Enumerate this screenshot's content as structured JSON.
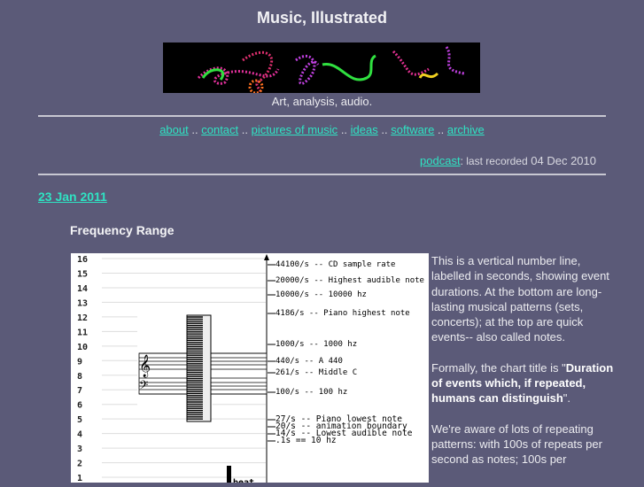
{
  "site": {
    "title": "Music, Illustrated",
    "tagline": "Art, analysis, audio."
  },
  "nav": {
    "items": [
      {
        "label": "about"
      },
      {
        "label": "contact"
      },
      {
        "label": "pictures of music"
      },
      {
        "label": "ideas"
      },
      {
        "label": "software"
      },
      {
        "label": "archive"
      }
    ],
    "separator": ".."
  },
  "podcast": {
    "link": "podcast",
    "text": ": last recorded",
    "date": "04 Dec 2010"
  },
  "post": {
    "date": "23 Jan 2011",
    "title": "Frequency Range",
    "paragraphs": [
      {
        "text": "This is a vertical number line, labelled in seconds, showing event durations.  At the bottom are long-lasting musical patterns (sets, concerts); at the top are quick events-- also called notes."
      },
      {
        "pre": "Formally, the chart title is \"",
        "bold": "Duration of events which, if repeated, humans can distinguish",
        "post": "\"."
      },
      {
        "text": "We're aware of lots of repeating patterns: with 100s of repeats per second as notes; 100s per"
      }
    ]
  },
  "figure": {
    "y_ticks": [
      "16",
      "15",
      "14",
      "13",
      "12",
      "11",
      "10",
      "9",
      "8",
      "7",
      "6",
      "5",
      "4",
      "3",
      "2",
      "1"
    ],
    "markers": [
      {
        "label": "44100/s -- CD sample rate"
      },
      {
        "label": "20000/s -- Highest audible note"
      },
      {
        "label": "10000/s -- 10000 hz"
      },
      {
        "label": " 4186/s -- Piano highest note"
      },
      {
        "label": " 1000/s -- 1000 hz"
      },
      {
        "label": "  440/s -- A 440"
      },
      {
        "label": "  261/s -- Middle C"
      },
      {
        "label": "  100/s -- 100 hz"
      },
      {
        "label": "   27/s -- Piano lowest note"
      },
      {
        "label": "   20/s -- animation boundary"
      },
      {
        "label": "   14/s -- Lowest audible note"
      },
      {
        "label": "    .1s == 10 hz"
      }
    ],
    "beat_label": "beat"
  },
  "colors": {
    "background": "#5b5a78",
    "link": "#2fe3c3",
    "text": "#ececf0"
  }
}
